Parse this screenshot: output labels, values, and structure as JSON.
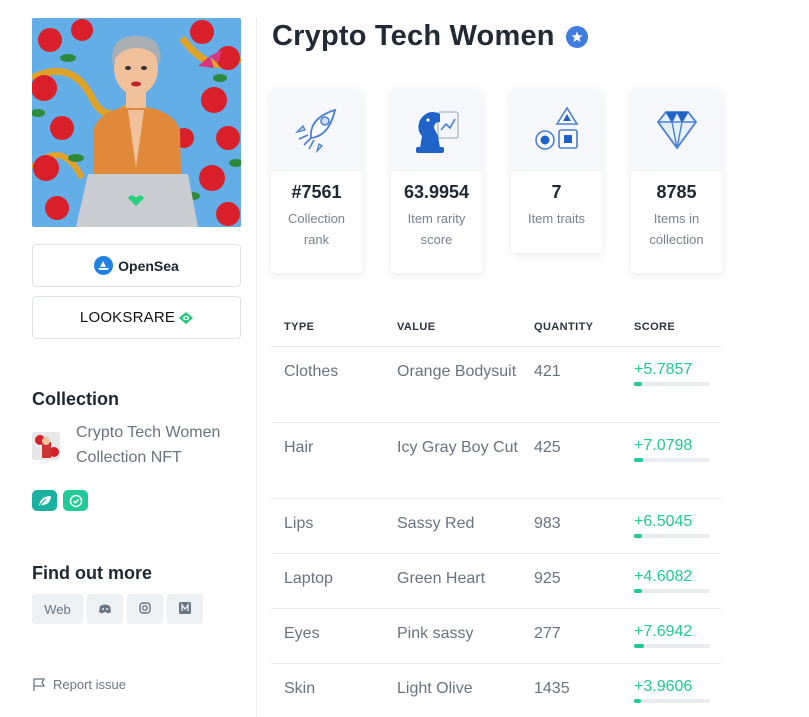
{
  "nft": {
    "image_alt": "Crypto Tech Women NFT artwork"
  },
  "marketplaces": {
    "opensea_label": "OpenSea",
    "looksrare_label": "LOOKSRARE"
  },
  "sidebar": {
    "collection_heading": "Collection",
    "collection_name": "Crypto Tech Women Collection NFT",
    "find_out_more_heading": "Find out more",
    "social": [
      {
        "label": "Web",
        "icon": "web"
      },
      {
        "label": "",
        "icon": "discord-icon"
      },
      {
        "label": "",
        "icon": "instagram-icon"
      },
      {
        "label": "",
        "icon": "medium-icon"
      }
    ],
    "report_label": "Report issue"
  },
  "title": "Crypto Tech Women",
  "stats": [
    {
      "value": "#7561",
      "label": "Collection rank",
      "icon": "rocket-icon"
    },
    {
      "value": "63.9954",
      "label": "Item rarity score",
      "icon": "chess-knight-icon"
    },
    {
      "value": "7",
      "label": "Item traits",
      "icon": "shapes-icon"
    },
    {
      "value": "8785",
      "label": "Items in collection",
      "icon": "diamond-icon"
    }
  ],
  "traits_table": {
    "headers": [
      "TYPE",
      "VALUE",
      "QUANTITY",
      "SCORE"
    ],
    "rows": [
      {
        "type": "Clothes",
        "value": "Orange Bodysuit",
        "quantity": "421",
        "score": "+5.7857",
        "fill": 0.1
      },
      {
        "type": "Hair",
        "value": "Icy Gray Boy Cut",
        "quantity": "425",
        "score": "+7.0798",
        "fill": 0.12
      },
      {
        "type": "Lips",
        "value": "Sassy Red",
        "quantity": "983",
        "score": "+6.5045",
        "fill": 0.11
      },
      {
        "type": "Laptop",
        "value": "Green Heart",
        "quantity": "925",
        "score": "+4.6082",
        "fill": 0.1
      },
      {
        "type": "Eyes",
        "value": "Pink sassy",
        "quantity": "277",
        "score": "+7.6942",
        "fill": 0.13
      },
      {
        "type": "Skin",
        "value": "Light Olive",
        "quantity": "1435",
        "score": "+3.9606",
        "fill": 0.09
      }
    ]
  },
  "colors": {
    "accent_green": "#20c997",
    "verified_blue": "#3f7ee0",
    "opensea_blue": "#2081e2"
  }
}
